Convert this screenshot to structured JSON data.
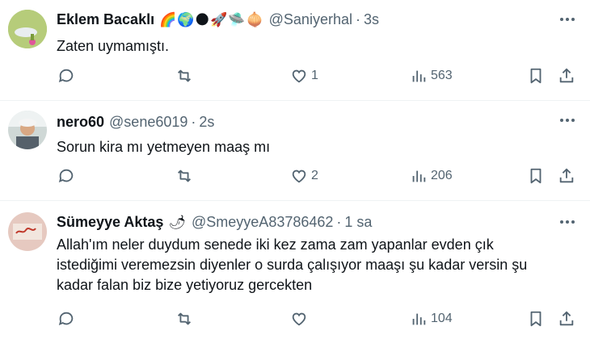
{
  "tweets": [
    {
      "name": "Eklem Bacaklı",
      "emojis": "🌈🌍🌑🚀🛸🧅",
      "handle": "@Saniyerhal",
      "time": "3s",
      "text": "Zaten uymamıştı.",
      "replies": "",
      "retweets": "",
      "likes": "1",
      "views": "563"
    },
    {
      "name": "nero60",
      "emojis": "",
      "handle": "@sene6019",
      "time": "2s",
      "text": "Sorun kira mı yetmeyen maaş mı",
      "replies": "",
      "retweets": "",
      "likes": "2",
      "views": "206"
    },
    {
      "name": "Sümeyye Aktaş",
      "emojis": "🌶",
      "handle": "@SmeyyeA83786462",
      "time": "1 sa",
      "text_lines": [
        "Allah'ım neler duydum senede iki kez zama zam yapanlar evden çık",
        "istediğimi veremezsin diyenler o surda çalışıyor maaşı şu kadar versin şu",
        "kadar falan biz bize yetiyoruz gercekten"
      ],
      "replies": "",
      "retweets": "",
      "likes": "",
      "views": "104"
    }
  ],
  "separator": "·",
  "colors": {
    "text": "#0f1419",
    "muted": "#536471",
    "divider": "#eff3f4"
  },
  "icons": [
    "reply-icon",
    "retweet-icon",
    "like-icon",
    "views-icon",
    "bookmark-icon",
    "share-icon",
    "more-icon"
  ]
}
